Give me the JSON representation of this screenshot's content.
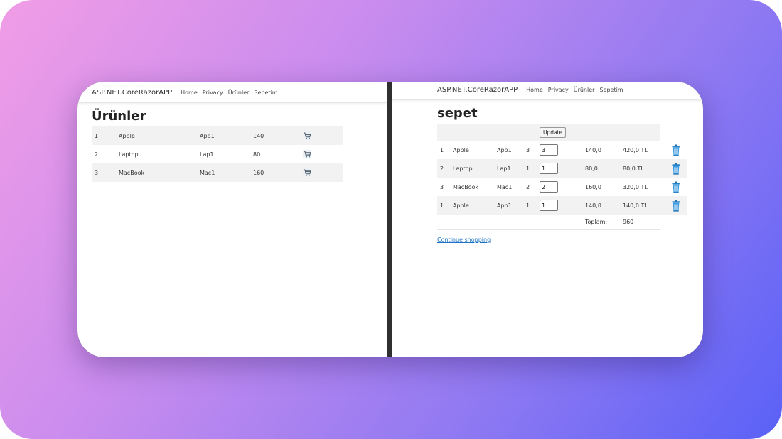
{
  "left": {
    "brand": "ASP.NET.CoreRazorAPP",
    "nav": [
      "Home",
      "Privacy",
      "Ürünler",
      "Sepetim"
    ],
    "title": "Ürünler",
    "products": [
      {
        "id": "1",
        "name": "Apple",
        "code": "App1",
        "price": "140"
      },
      {
        "id": "2",
        "name": "Laptop",
        "code": "Lap1",
        "price": "80"
      },
      {
        "id": "3",
        "name": "MacBook",
        "code": "Mac1",
        "price": "160"
      }
    ]
  },
  "right": {
    "brand": "ASP.NET.CoreRazorAPP",
    "nav": [
      "Home",
      "Privacy",
      "Ürünler",
      "Sepetim"
    ],
    "title": "sepet",
    "update_label": "Update",
    "items": [
      {
        "id": "1",
        "name": "Apple",
        "code": "App1",
        "qty": "3",
        "qty_input": "3",
        "unit": "140,0",
        "total": "420,0 TL"
      },
      {
        "id": "2",
        "name": "Laptop",
        "code": "Lap1",
        "qty": "1",
        "qty_input": "1",
        "unit": "80,0",
        "total": "80,0 TL"
      },
      {
        "id": "3",
        "name": "MacBook",
        "code": "Mac1",
        "qty": "2",
        "qty_input": "2",
        "unit": "160,0",
        "total": "320,0 TL"
      },
      {
        "id": "1",
        "name": "Apple",
        "code": "App1",
        "qty": "1",
        "qty_input": "1",
        "unit": "140,0",
        "total": "140,0 TL"
      }
    ],
    "total_label": "Toplam:",
    "total_value": "960",
    "continue_label": "Continue shopping"
  },
  "colors": {
    "gradient_start": "#f19de6",
    "gradient_end": "#5a61f7",
    "link": "#1a73c9",
    "row_stripe": "#f2f2f2"
  },
  "icons": {
    "cart": "shopping-cart-icon",
    "delete": "trash-icon"
  }
}
